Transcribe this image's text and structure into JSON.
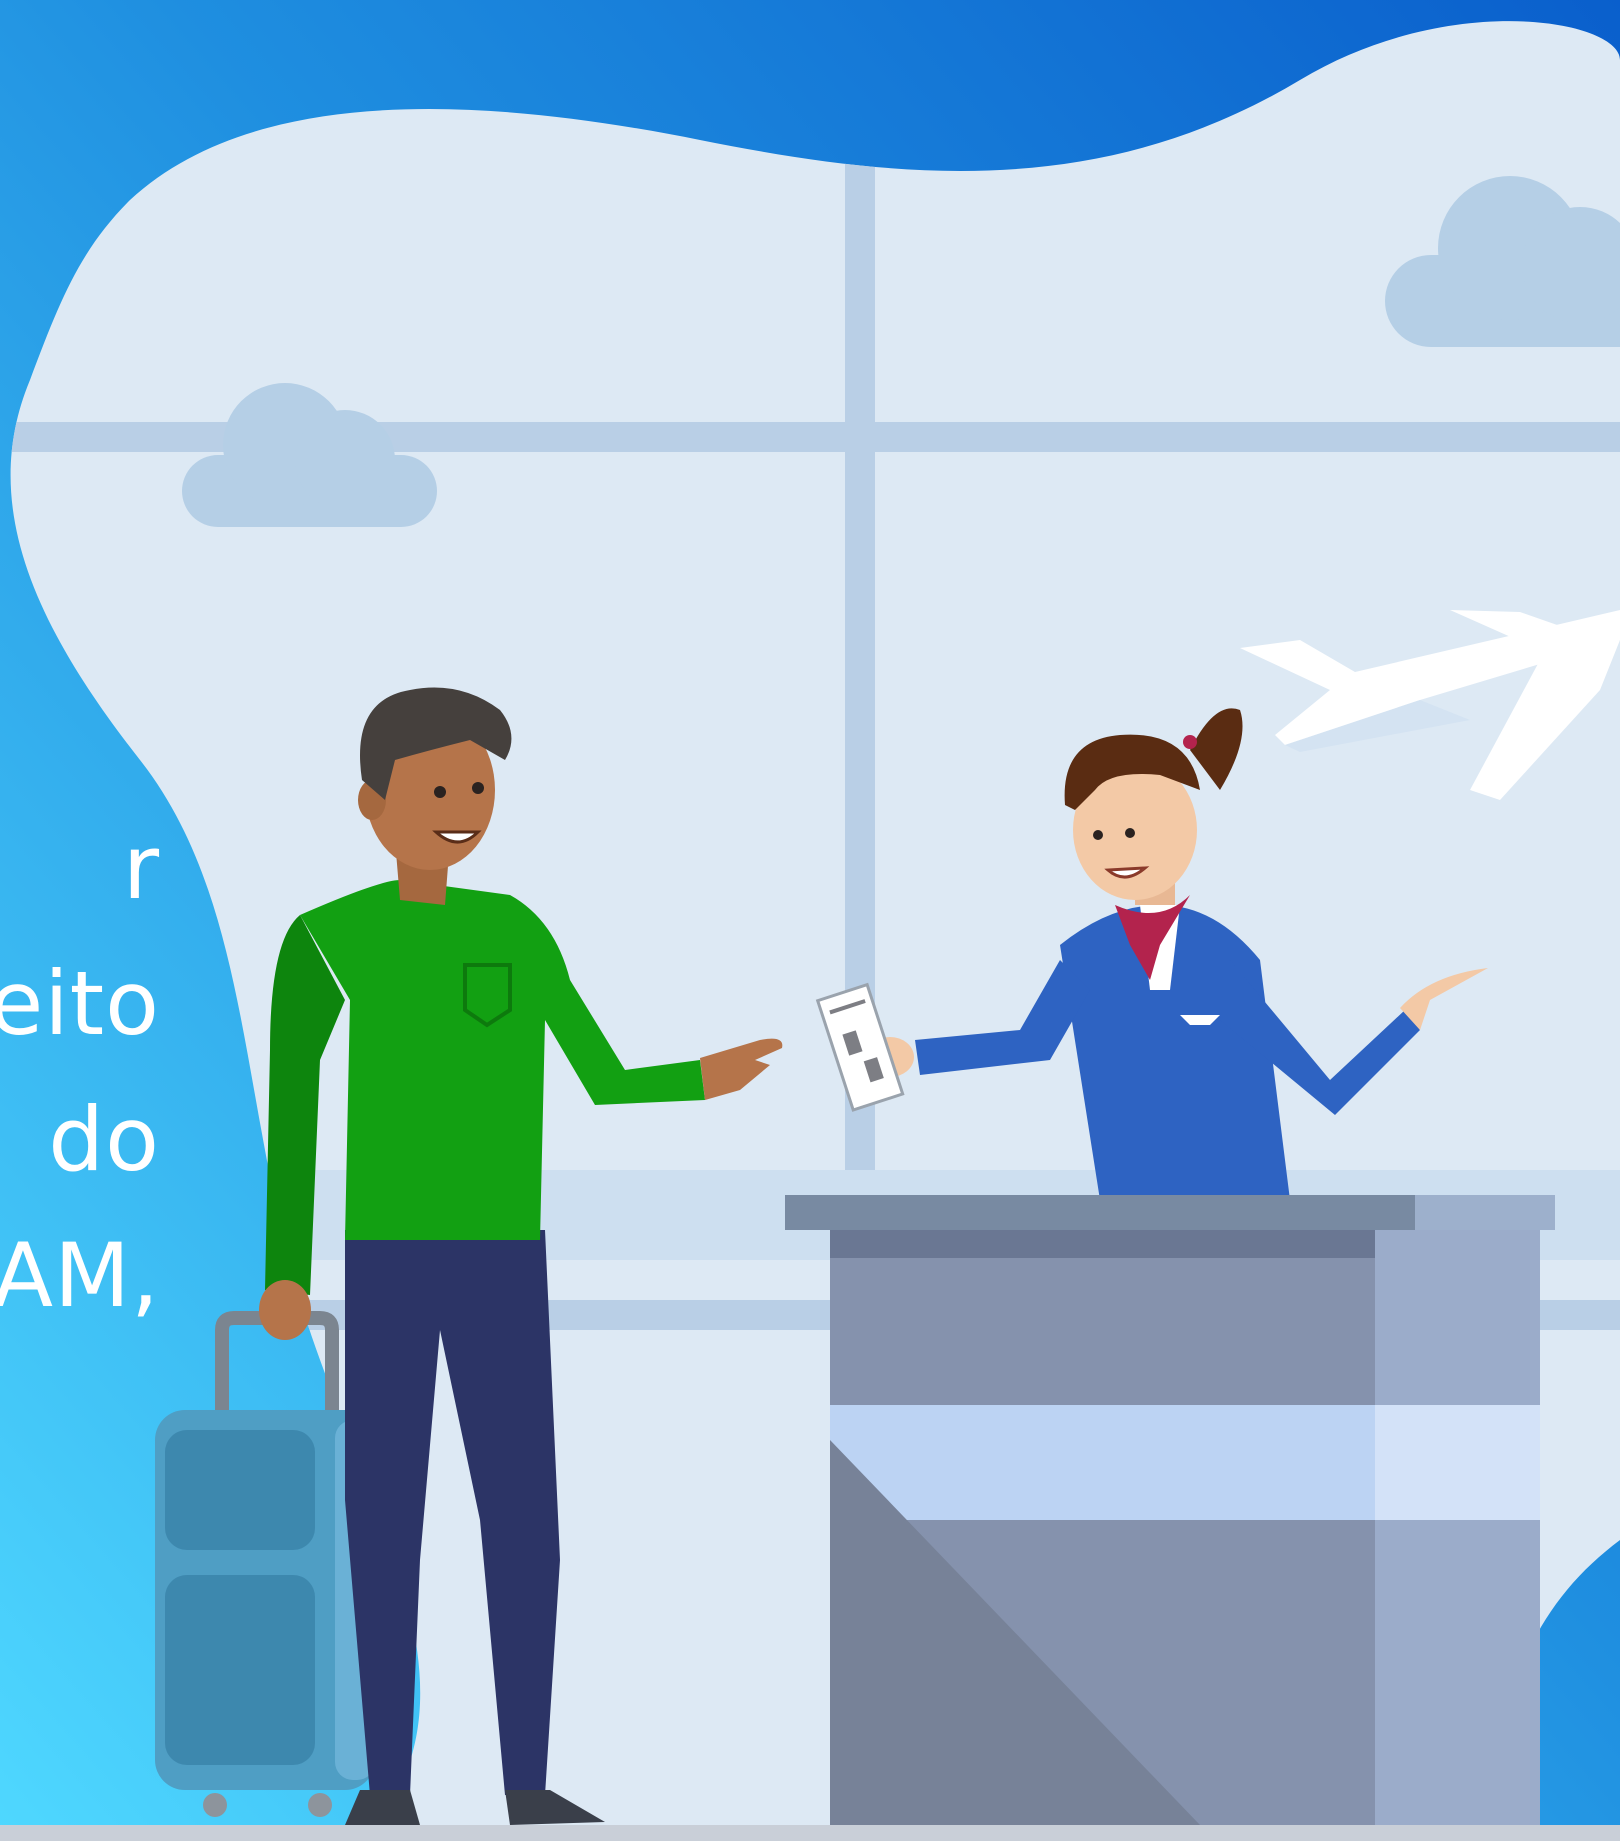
{
  "promo": {
    "lines": [
      "r",
      "eito",
      "do",
      "AM,"
    ]
  },
  "colors": {
    "sky_top": "#0a5fcc",
    "sky_bottom": "#4fd8ff",
    "window_bg": "#dde9f4",
    "window_frame": "#b9cfe6",
    "cloud": "#b5cfe6",
    "plane": "#ffffff",
    "man_shirt": "#12a012",
    "man_pants": "#2c3466",
    "man_skin": "#b5744a",
    "suitcase": "#4f9ec4",
    "attendant_uniform": "#2e63c2",
    "scarf": "#b3234d",
    "counter": "#8592ad",
    "counter_band": "#bcd3f3"
  },
  "icons": {
    "plane": "plane-icon",
    "boarding_pass": "ticket-icon",
    "suitcase": "suitcase-icon"
  }
}
